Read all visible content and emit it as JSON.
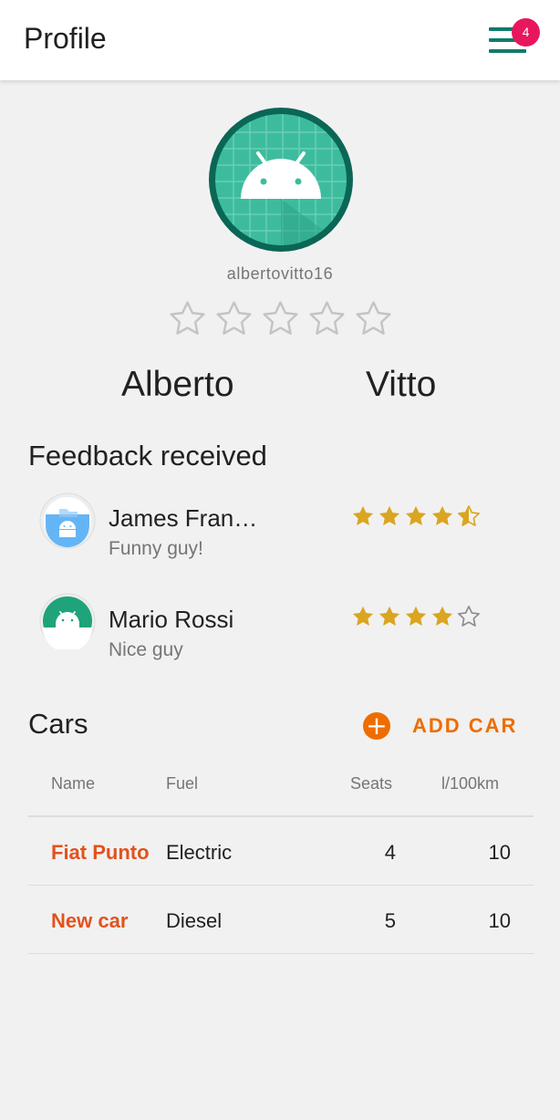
{
  "appbar": {
    "title": "Profile",
    "notification_count": "4",
    "menu_icon": "hamburger-menu-icon"
  },
  "profile": {
    "avatar_icon": "android-icon",
    "username": "albertovitto16",
    "rating": 0,
    "rating_max": 5,
    "first_name": "Alberto",
    "last_name": "Vitto"
  },
  "feedback": {
    "title": "Feedback received",
    "items": [
      {
        "name": "James Fran…",
        "comment": "Funny guy!",
        "rating": 4.5,
        "avatar_color": "#64b5f6"
      },
      {
        "name": "Mario Rossi",
        "comment": "Nice guy",
        "rating": 4,
        "avatar_color": "#1fa37a"
      }
    ]
  },
  "cars": {
    "title": "Cars",
    "add_label": "ADD CAR",
    "add_icon": "add-circle-icon",
    "columns": [
      "Name",
      "Fuel",
      "Seats",
      "l/100km"
    ],
    "rows": [
      {
        "name": "Fiat Punto",
        "fuel": "Electric",
        "seats": "4",
        "consumption": "10"
      },
      {
        "name": "New car",
        "fuel": "Diesel",
        "seats": "5",
        "consumption": "10"
      }
    ]
  },
  "colors": {
    "primary": "#137a6c",
    "accent": "#ef6c00",
    "badge": "#e8175d",
    "star_gold": "#daa520",
    "car_name": "#e2521d"
  }
}
